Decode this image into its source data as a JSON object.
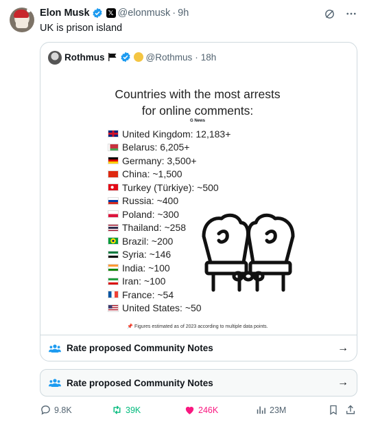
{
  "post": {
    "author_name": "Elon Musk",
    "handle": "@elonmusk",
    "time": "9h",
    "text": "UK is prison island"
  },
  "quoted": {
    "author_name": "Rothmus",
    "handle": "@Rothmus",
    "time": "18h",
    "image": {
      "title_line1": "Countries with the most arrests",
      "title_line2": "for online comments:",
      "source": "G News",
      "items": [
        {
          "country": "United Kingdom: 12,183+"
        },
        {
          "country": "Belarus: 6,205+"
        },
        {
          "country": "Germany: 3,500+"
        },
        {
          "country": "China: ~1,500"
        },
        {
          "country": "Turkey (Türkiye): ~500"
        },
        {
          "country": "Russia: ~400"
        },
        {
          "country": "Poland: ~300"
        },
        {
          "country": "Thailand: ~258"
        },
        {
          "country": "Brazil: ~200"
        },
        {
          "country": "Syria: ~146"
        },
        {
          "country": "India: ~100"
        },
        {
          "country": "Iran: ~100"
        },
        {
          "country": "France: ~54"
        },
        {
          "country": "United States: ~50"
        }
      ],
      "footnote": "📌 Figures estimated as of 2023 according to multiple data points."
    },
    "notes_label": "Rate proposed Community Notes"
  },
  "outer_notes_label": "Rate proposed Community Notes",
  "actions": {
    "replies": "9.8K",
    "reposts": "39K",
    "likes": "246K",
    "views": "23M"
  },
  "colors": {
    "verified": "#1d9bf0",
    "repost": "#00ba7c",
    "like": "#f91880",
    "muted": "#536471"
  }
}
